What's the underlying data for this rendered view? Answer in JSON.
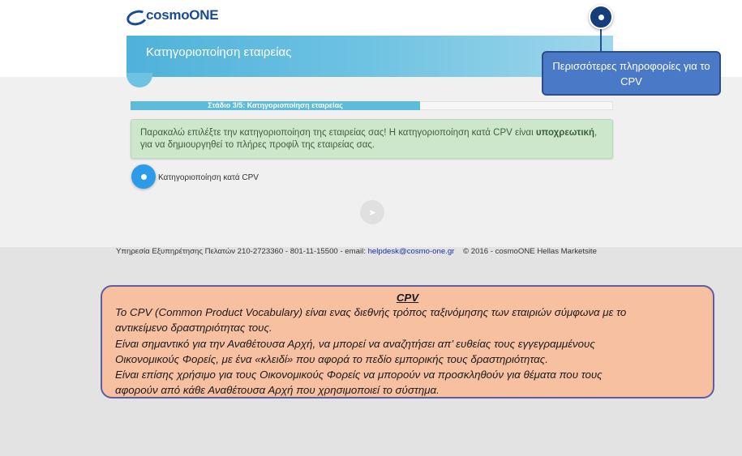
{
  "header": {
    "logo": "cosmoONE",
    "info_icon": "info-icon"
  },
  "banner": {
    "title": "Κατηγοριοποίηση εταιρείας"
  },
  "callout": {
    "text": "Περισσότερες πληροφορίες για το CPV"
  },
  "progress": {
    "label": "Στάδιο 3/5: Κατηγοριοποίηση εταιρείας",
    "value": 0.6
  },
  "alert": {
    "text_before": "Παρακαλώ επιλέξτε την κατηγοριοποίηση της εταιρείας σας! Η κατηγοριοποίηση κατά CPV είναι ",
    "text_bold": "υποχρεωτική",
    "text_after": ", για να δημιουργηθεί το πλήρες προφίλ της εταιρείας σας."
  },
  "cpv_option": {
    "label": "Κατηγοριοποίηση κατά CPV"
  },
  "next_button": {
    "icon": "➤"
  },
  "footer": {
    "service_text": "Υπηρεσία Εξυπηρέτησης Πελατών 210-2723360 - 801-11-15500 - email:",
    "email": "helpdesk@cosmo-one.gr",
    "copyright": "© 2016 - cosmoONE Hellas Marketsite"
  },
  "info_box": {
    "title": "CPV",
    "lines": [
      "Το CPV (Common Product Vocabulary) είναι ενας διεθνής τρόπος ταξινόμησης των εταιριών σύμφωνα με το",
      "αντικείμενο δραστηριότητας τους.",
      "Είναι σημαντικό για την Αναθέτουσα Αρχή, να μπορεί να αναζητήσει απ’ ευθείας τους εγγεγραμμένους",
      "Οικονομικούς Φορείς, με ένα «κλειδί» που αφορά το πεδίο εμπορικής τους δραστηριότητας.",
      "Είναι επίσης χρήσιμο για τους Οικονομικούς Φορείς να μπορούν να προσκληθούν για θέματα που τους",
      "αφορούν από κάθε Αναθέτουσα Αρχή που χρησιμοποιεί το σύστημα."
    ]
  },
  "colors": {
    "brand_blue": "#1b4a9b",
    "banner_blue": "#4fb2da",
    "alert_green": "#cde7cd",
    "info_box_fill": "#f7c0a0",
    "callout_blue": "#4a79c7"
  }
}
